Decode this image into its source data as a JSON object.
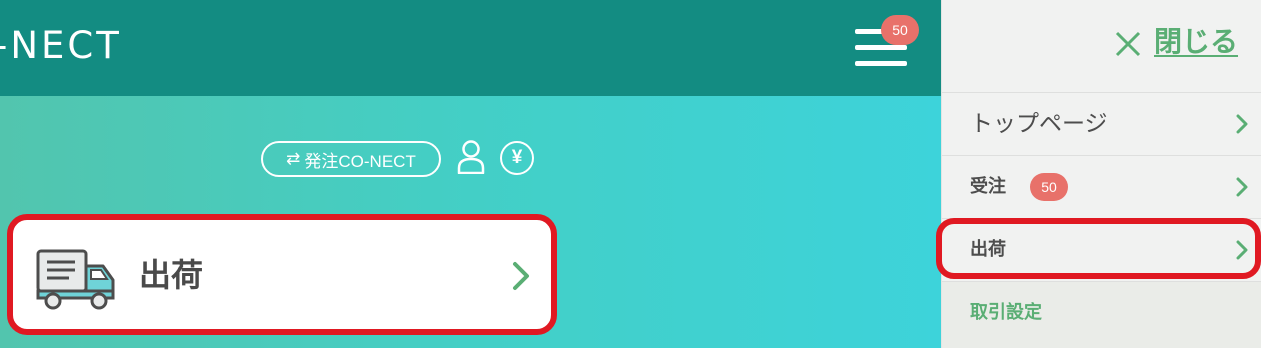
{
  "header": {
    "logo": "-NECT",
    "notification_count": "50"
  },
  "toolbar": {
    "switch_label": "発注CO-NECT",
    "switch_arrow": "⇄",
    "yen_symbol": "¥"
  },
  "card": {
    "label": "出荷"
  },
  "side_menu": {
    "close_label": "閉じる",
    "items": [
      {
        "label": "トップページ"
      },
      {
        "label": "受注",
        "badge": "50"
      },
      {
        "label": "出荷"
      },
      {
        "label": "取引設定"
      }
    ]
  },
  "colors": {
    "header_bg": "#138c82",
    "accent_green": "#5aae74",
    "badge": "#e8716a",
    "highlight": "#e01922"
  }
}
